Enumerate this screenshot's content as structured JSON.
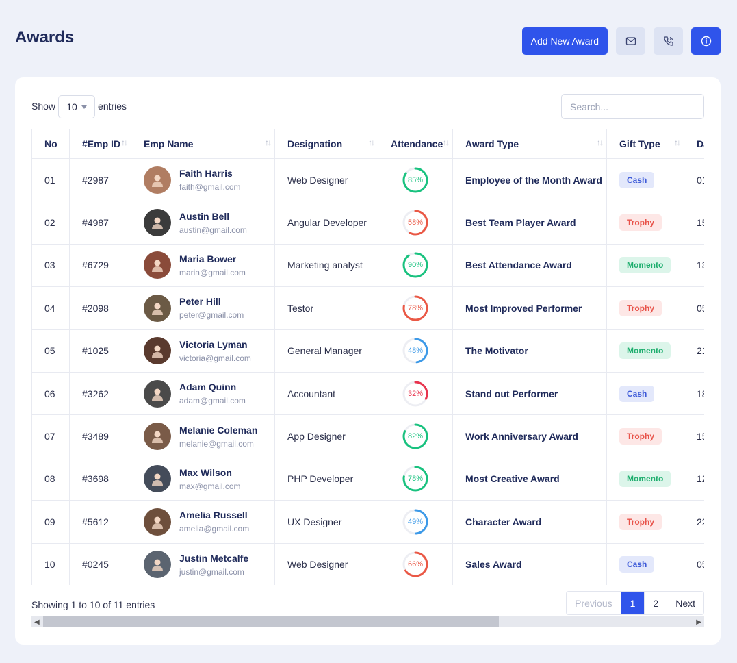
{
  "header": {
    "title": "Awards",
    "add_button": "Add New Award"
  },
  "controls": {
    "show_label": "Show",
    "entries_value": "10",
    "entries_label": "entries",
    "search_placeholder": "Search..."
  },
  "table": {
    "columns": [
      "No",
      "#Emp ID",
      "Emp Name",
      "Designation",
      "Attendance",
      "Award Type",
      "Gift Type",
      "Da"
    ],
    "rows": [
      {
        "no": "01",
        "id": "#2987",
        "name": "Faith Harris",
        "email": "faith@gmail.com",
        "designation": "Web Designer",
        "attendance": 85,
        "attendance_label": "85%",
        "attendance_color": "#19c27f",
        "award": "Employee of the Month Award",
        "gift": "Cash",
        "gift_kind": "cash",
        "date": "01"
      },
      {
        "no": "02",
        "id": "#4987",
        "name": "Austin Bell",
        "email": "austin@gmail.com",
        "designation": "Angular Developer",
        "attendance": 58,
        "attendance_label": "58%",
        "attendance_color": "#ea5845",
        "award": "Best Team Player Award",
        "gift": "Trophy",
        "gift_kind": "trophy",
        "date": "15"
      },
      {
        "no": "03",
        "id": "#6729",
        "name": "Maria Bower",
        "email": "maria@gmail.com",
        "designation": "Marketing analyst",
        "attendance": 90,
        "attendance_label": "90%",
        "attendance_color": "#19c27f",
        "award": "Best Attendance Award",
        "gift": "Momento",
        "gift_kind": "momento",
        "date": "13"
      },
      {
        "no": "04",
        "id": "#2098",
        "name": "Peter Hill",
        "email": "peter@gmail.com",
        "designation": "Testor",
        "attendance": 78,
        "attendance_label": "78%",
        "attendance_color": "#ea5845",
        "award": "Most Improved Performer",
        "gift": "Trophy",
        "gift_kind": "trophy",
        "date": "05"
      },
      {
        "no": "05",
        "id": "#1025",
        "name": "Victoria Lyman",
        "email": "victoria@gmail.com",
        "designation": "General Manager",
        "attendance": 48,
        "attendance_label": "48%",
        "attendance_color": "#3d9ae8",
        "award": "The Motivator",
        "gift": "Momento",
        "gift_kind": "momento",
        "date": "21"
      },
      {
        "no": "06",
        "id": "#3262",
        "name": "Adam Quinn",
        "email": "adam@gmail.com",
        "designation": "Accountant",
        "attendance": 32,
        "attendance_label": "32%",
        "attendance_color": "#e8344e",
        "award": "Stand out Performer",
        "gift": "Cash",
        "gift_kind": "cash",
        "date": "18"
      },
      {
        "no": "07",
        "id": "#3489",
        "name": "Melanie Coleman",
        "email": "melanie@gmail.com",
        "designation": "App Designer",
        "attendance": 82,
        "attendance_label": "82%",
        "attendance_color": "#19c27f",
        "award": "Work Anniversary Award",
        "gift": "Trophy",
        "gift_kind": "trophy",
        "date": "15"
      },
      {
        "no": "08",
        "id": "#3698",
        "name": "Max Wilson",
        "email": "max@gmail.com",
        "designation": "PHP Developer",
        "attendance": 78,
        "attendance_label": "78%",
        "attendance_color": "#19c27f",
        "award": "Most Creative Award",
        "gift": "Momento",
        "gift_kind": "momento",
        "date": "12"
      },
      {
        "no": "09",
        "id": "#5612",
        "name": "Amelia Russell",
        "email": "amelia@gmail.com",
        "designation": "UX Designer",
        "attendance": 49,
        "attendance_label": "49%",
        "attendance_color": "#3d9ae8",
        "award": "Character Award",
        "gift": "Trophy",
        "gift_kind": "trophy",
        "date": "22"
      },
      {
        "no": "10",
        "id": "#0245",
        "name": "Justin Metcalfe",
        "email": "justin@gmail.com",
        "designation": "Web Designer",
        "attendance": 66,
        "attendance_label": "66%",
        "attendance_color": "#ea5845",
        "award": "Sales Award",
        "gift": "Cash",
        "gift_kind": "cash",
        "date": "05"
      }
    ]
  },
  "footer": {
    "info": "Showing 1 to 10 of 11 entries",
    "pagination": [
      "Previous",
      "1",
      "2",
      "Next"
    ]
  },
  "icons": [
    "mail-icon",
    "phone-icon",
    "info-icon",
    "sort-icon",
    "chevron-left-icon",
    "chevron-right-icon"
  ],
  "colors": {
    "accent": "#2f54eb",
    "background": "#eef1f9"
  }
}
